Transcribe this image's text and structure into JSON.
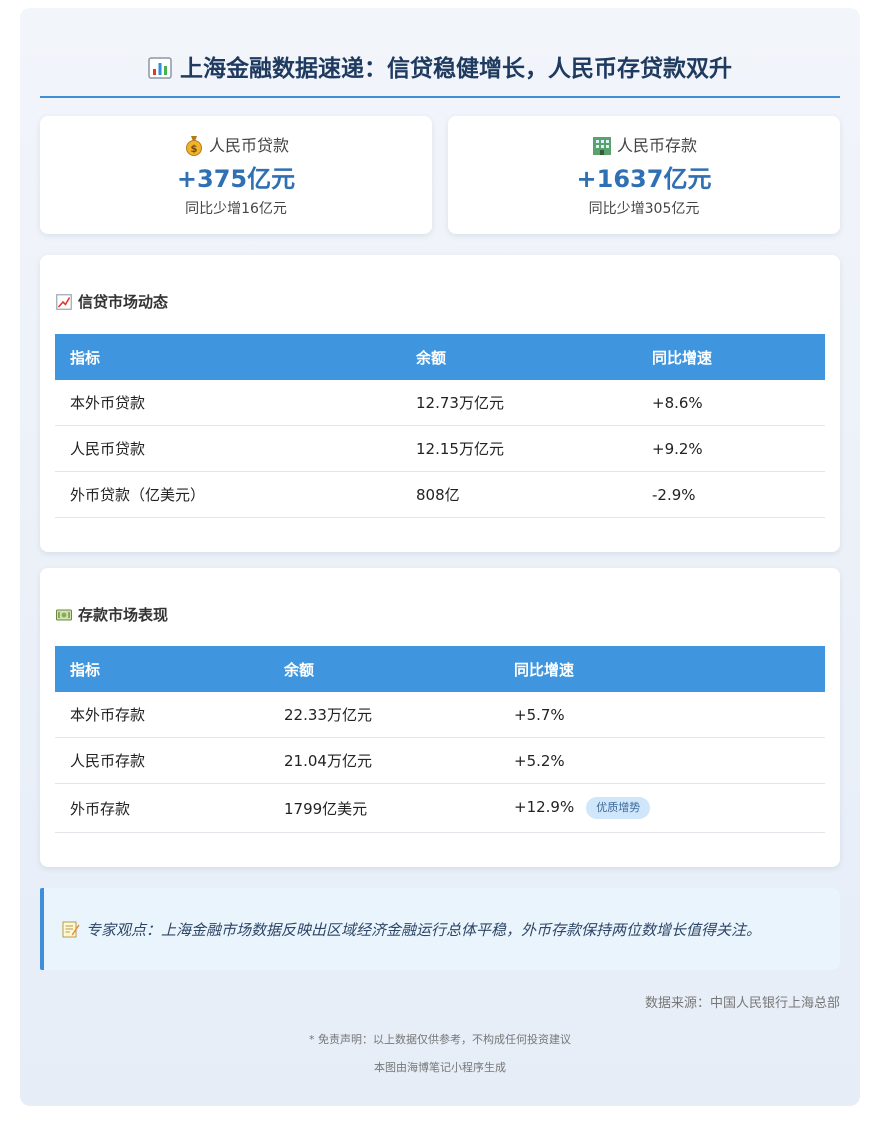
{
  "header": {
    "title": "上海金融数据速递：信贷稳健增长，人民币存贷款双升",
    "icon": "bar-chart-icon"
  },
  "stats": [
    {
      "label": "人民币贷款",
      "value": "+375亿元",
      "sub": "同比少增16亿元",
      "icon": "money-bag-icon"
    },
    {
      "label": "人民币存款",
      "value": "+1637亿元",
      "sub": "同比少增305亿元",
      "icon": "bank-building-icon"
    }
  ],
  "credit": {
    "title": "信贷市场动态",
    "icon": "trend-chart-icon",
    "columns": [
      "指标",
      "余额",
      "同比增速"
    ],
    "rows": [
      [
        "本外币贷款",
        "12.73万亿元",
        "+8.6%"
      ],
      [
        "人民币贷款",
        "12.15万亿元",
        "+9.2%"
      ],
      [
        "外币贷款（亿美元）",
        "808亿",
        "-2.9%"
      ]
    ]
  },
  "deposit": {
    "title": "存款市场表现",
    "icon": "banknote-icon",
    "columns": [
      "指标",
      "余额",
      "同比增速"
    ],
    "rows": [
      [
        "本外币存款",
        "22.33万亿元",
        "+5.7%"
      ],
      [
        "人民币存款",
        "21.04万亿元",
        "+5.2%"
      ],
      [
        "外币存款",
        "1799亿美元",
        "+12.9%"
      ]
    ],
    "badge": "优质增势"
  },
  "expert": {
    "text": "专家观点：上海金融市场数据反映出区域经济金融运行总体平稳，外币存款保持两位数增长值得关注。",
    "icon": "memo-icon"
  },
  "source": "数据来源：中国人民银行上海总部",
  "disclaimer": "* 免责声明：以上数据仅供参考，不构成任何投资建议",
  "generated": "本图由海博笔记小程序生成",
  "colors": {
    "accent": "#3f96df",
    "value": "#2f6fb3",
    "title": "#1f3a5f"
  }
}
